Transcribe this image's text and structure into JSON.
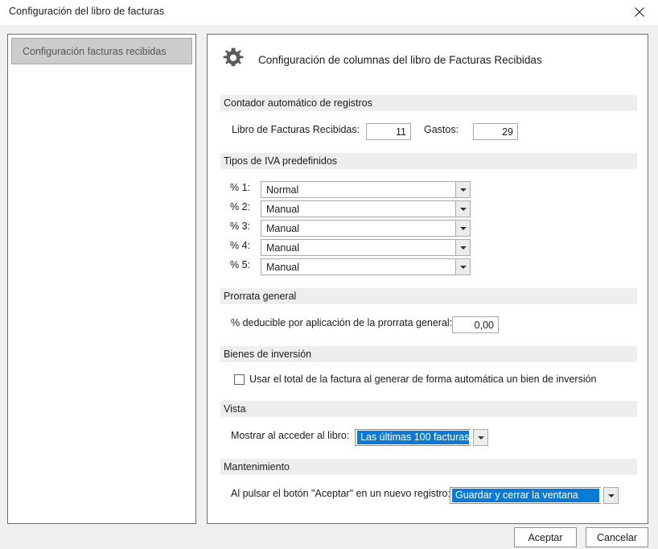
{
  "window": {
    "title": "Configuración del libro de facturas",
    "close_icon": "close-icon"
  },
  "sidebar": {
    "items": [
      {
        "label": "Configuración facturas recibidas"
      }
    ]
  },
  "panel": {
    "icon": "gear-icon",
    "title": "Configuración de columnas del libro de Facturas Recibidas",
    "sections": {
      "counter": {
        "header": "Contador automático de registros",
        "fields": [
          {
            "label": "Libro de Facturas Recibidas:",
            "value": "11"
          },
          {
            "label": "Gastos:",
            "value": "29"
          }
        ]
      },
      "vat": {
        "header": "Tipos de IVA predefinidos",
        "rows": [
          {
            "label": "% 1:",
            "value": "Normal"
          },
          {
            "label": "% 2:",
            "value": "Manual"
          },
          {
            "label": "% 3:",
            "value": "Manual"
          },
          {
            "label": "% 4:",
            "value": "Manual"
          },
          {
            "label": "% 5:",
            "value": "Manual"
          }
        ]
      },
      "prorrata": {
        "header": "Prorrata general",
        "label": "% deducible por aplicación de la prorrata general:",
        "value": "0,00"
      },
      "investment": {
        "header": "Bienes de inversión",
        "checkbox_label": "Usar el total de la factura al generar de forma automática un bien de inversión",
        "checked": false
      },
      "view": {
        "header": "Vista",
        "label": "Mostrar al acceder al libro:",
        "value": "Las últimas 100 facturas"
      },
      "maintenance": {
        "header": "Mantenimiento",
        "label": "Al pulsar el botón \"Aceptar\" en un nuevo registro:",
        "value": "Guardar y cerrar la ventana"
      }
    }
  },
  "footer": {
    "accept_label": "Aceptar",
    "cancel_label": "Cancelar"
  },
  "colors": {
    "selection_blue": "#0a7ad6",
    "section_bar": "#eeeeee",
    "dialog_bg": "#f0f0f0",
    "nav_selected": "#cccccc",
    "gear": "#5a5a5a"
  }
}
